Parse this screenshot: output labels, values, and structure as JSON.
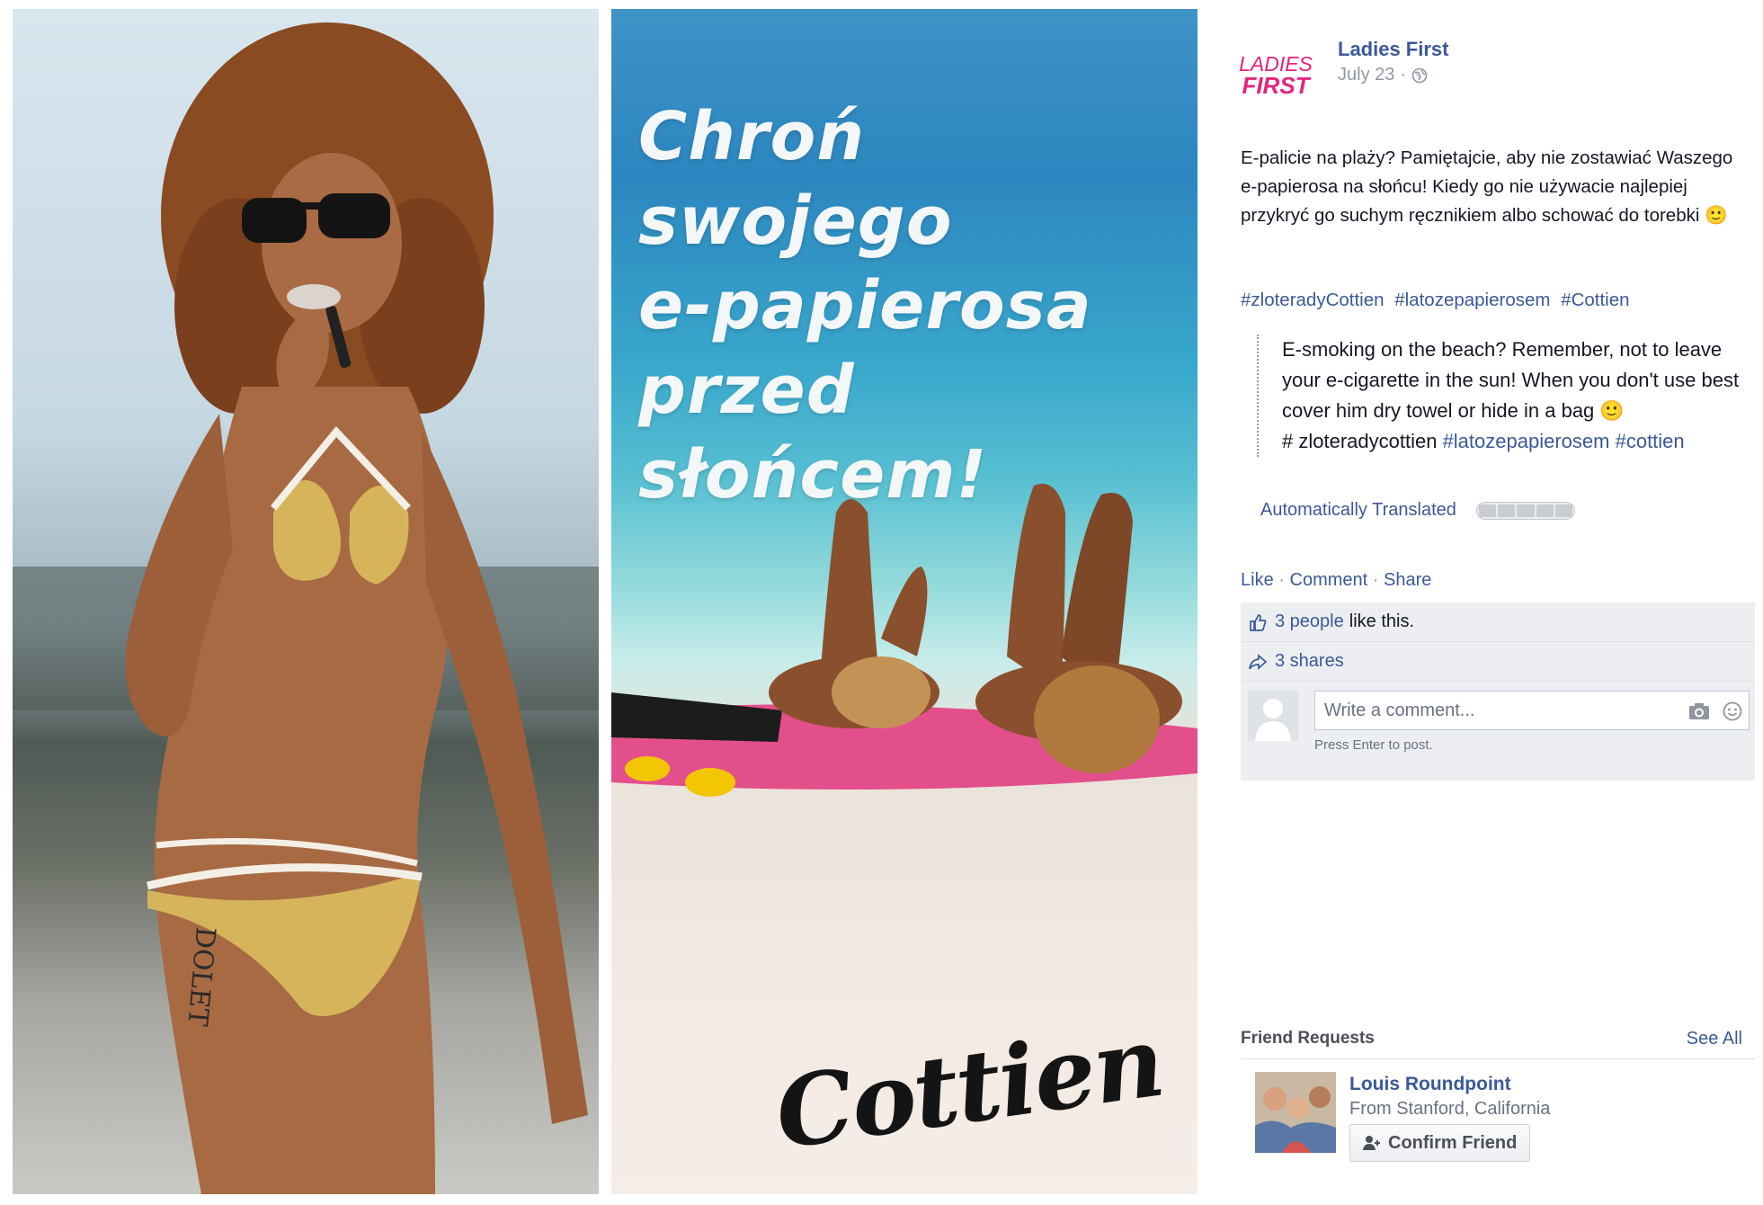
{
  "post": {
    "page_name": "Ladies First",
    "avatar_line1": "LADIES",
    "avatar_line2": "FIRST",
    "date": "July 23",
    "date_separator": "·",
    "text": "E-palicie na plaży? Pamiętajcie, aby nie zostawiać Waszego e-papierosa na słońcu! Kiedy go nie używacie najlepiej przykryć go suchym ręcznikiem albo schować do torebki 🙂",
    "hashtags": [
      "#zloteradyCottien",
      "#latozepapierosem",
      "#Cottien"
    ],
    "translation": {
      "text": "E-smoking on the beach? Remember, not to leave your e-cigarette in the sun! When you don't use best cover him dry towel or hide in a bag 🙂",
      "plain_tag": "# zloteradycottien",
      "tag1": "#latozepapierosem",
      "tag2": "#cottien",
      "auto_label": "Automatically Translated"
    },
    "actions": {
      "like": "Like",
      "comment": "Comment",
      "share": "Share",
      "sep": "·"
    },
    "likes": {
      "count_text": "3 people",
      "suffix": "like this."
    },
    "shares": {
      "text": "3 shares"
    },
    "comment": {
      "placeholder": "Write a comment...",
      "hint": "Press Enter to post."
    }
  },
  "photo": {
    "headline": [
      "Chroń swojego",
      "e-papierosa",
      "przed słońcem!"
    ],
    "brand": "Cottien"
  },
  "friend_requests": {
    "title": "Friend Requests",
    "see_all": "See All",
    "items": [
      {
        "name": "Louis Roundpoint",
        "from": "From Stanford, California",
        "button": "Confirm Friend"
      }
    ]
  },
  "colors": {
    "link": "#3b5998",
    "brand_pink": "#e5247f",
    "muted": "#9197a3"
  },
  "icons": [
    "globe-icon",
    "thumbs-up-icon",
    "share-arrow-icon",
    "camera-icon",
    "smiley-icon",
    "add-friend-icon"
  ]
}
